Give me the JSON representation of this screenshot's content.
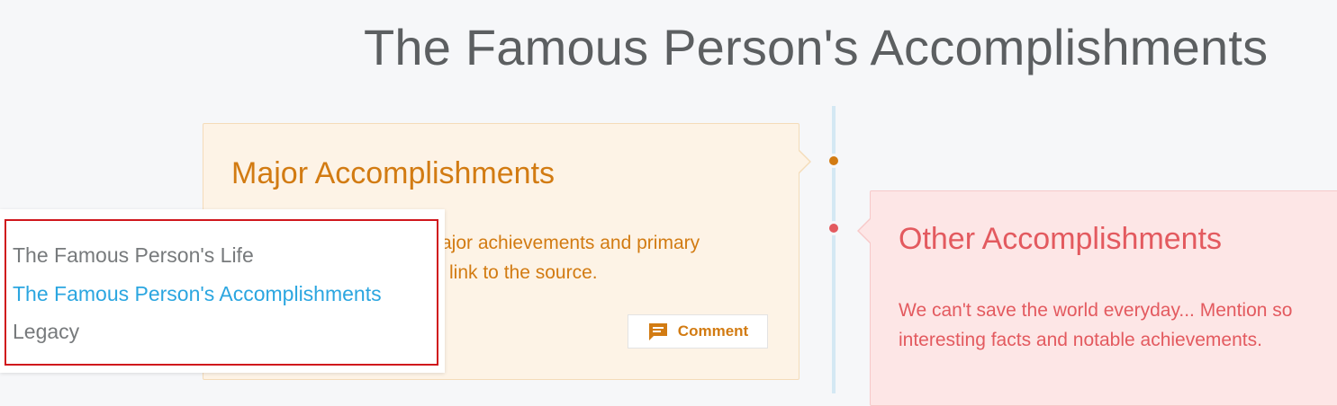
{
  "page": {
    "title": "The Famous Person's Accomplishments"
  },
  "timeline": {
    "line_color": "#d4e8f3",
    "dots": [
      {
        "color": "#d27b12"
      },
      {
        "color": "#e35a5f"
      }
    ]
  },
  "major_card": {
    "title": "Major Accomplishments",
    "body": "ajor achievements and primary link to the source.",
    "body_line1": "ajor achievements and primary",
    "body_line2": "link to the source.",
    "comment_label": "Comment",
    "comment_icon": "comment-icon",
    "accent_color": "#d27b12",
    "background_color": "#fdf3e6"
  },
  "other_card": {
    "title": "Other Accomplishments",
    "body_line1": "We can't save the world everyday... Mention so",
    "body_line2": "interesting facts and notable achievements.",
    "accent_color": "#e35a5f",
    "background_color": "#fde6e6"
  },
  "nav_menu": {
    "items": [
      {
        "label": "The Famous Person's Life",
        "active": false
      },
      {
        "label": "The Famous Person's Accomplishments",
        "active": true
      },
      {
        "label": "Legacy",
        "active": false
      }
    ],
    "active_color": "#2ba6e0",
    "highlight_color": "#d0161c"
  }
}
